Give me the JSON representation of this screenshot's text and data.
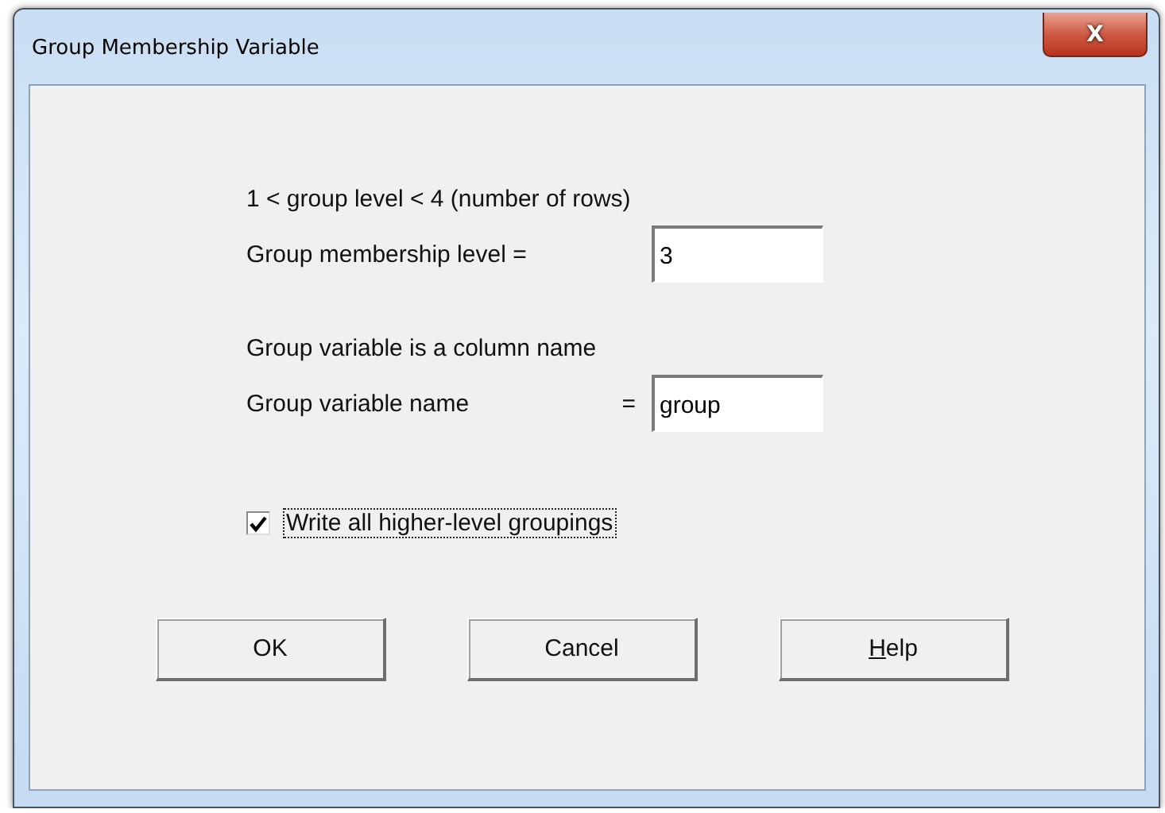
{
  "window": {
    "title": "Group Membership Variable",
    "close": "X"
  },
  "range_hint": "1 < group level < 4 (number of rows)",
  "fields": [
    {
      "label": "Group membership level =",
      "value": "3"
    },
    {
      "label": "Group variable name",
      "equals": "=",
      "value": "group"
    }
  ],
  "field_hint": "Group variable is a column name",
  "checkbox": {
    "label": "Write all higher-level groupings",
    "checked": true,
    "focused": true
  },
  "buttons": [
    {
      "label": "OK",
      "first_letter_underlined": false
    },
    {
      "label": "Cancel",
      "first_letter_underlined": false
    },
    {
      "label": "Help",
      "first_letter_underlined": true
    }
  ]
}
